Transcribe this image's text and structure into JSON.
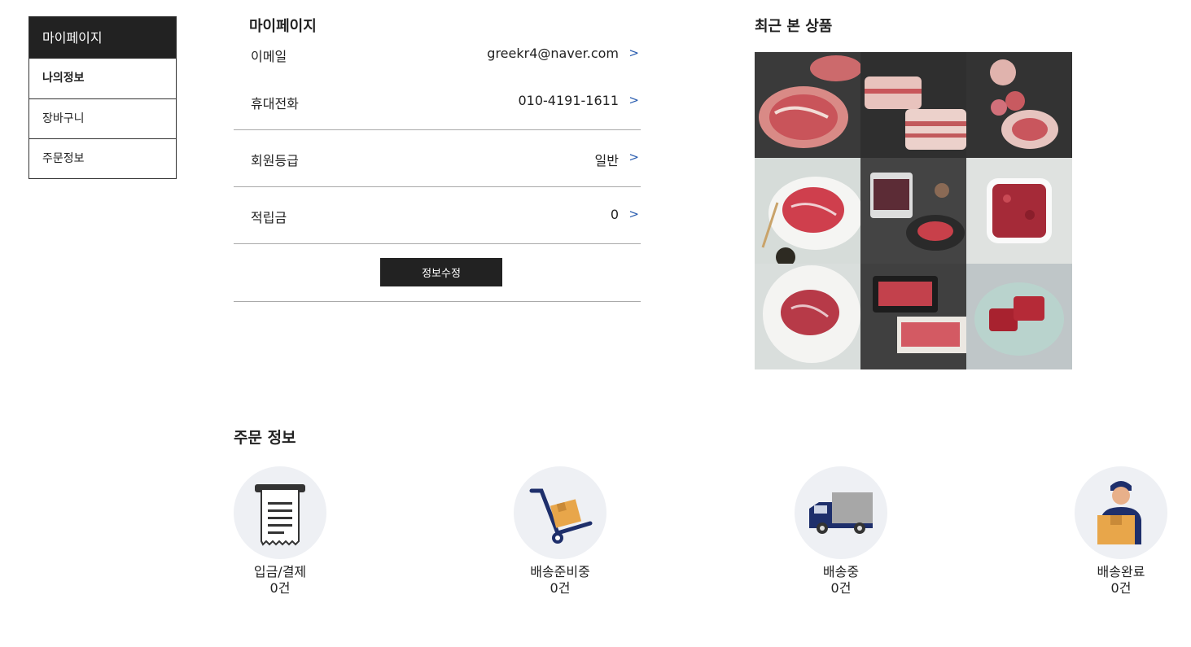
{
  "sidebar": {
    "title": "마이페이지",
    "items": [
      {
        "label": "나의정보"
      },
      {
        "label": "장바구니"
      },
      {
        "label": "주문정보"
      }
    ]
  },
  "info": {
    "title": "마이페이지",
    "email_label": "이메일",
    "email_value": "greekr4@naver.com",
    "phone_label": "휴대전화",
    "phone_value": "010-4191-1611",
    "grade_label": "회원등급",
    "grade_value": "일반",
    "points_label": "적립금",
    "points_value": "0",
    "arrow": ">",
    "edit_button": "정보수정"
  },
  "recent": {
    "title": "최근 본 상품",
    "products": [
      "pork-neck",
      "pork-belly",
      "pork-chunks",
      "sliced-beef-plate",
      "packaged-beef",
      "ground-beef-bowl",
      "steak-plate",
      "packaged-sirloin",
      "beef-cubes-plate"
    ]
  },
  "orders": {
    "title": "주문 정보",
    "statuses": [
      {
        "name": "입금/결제",
        "count": "0건",
        "icon": "receipt-icon"
      },
      {
        "name": "배송준비중",
        "count": "0건",
        "icon": "hand-truck-icon"
      },
      {
        "name": "배송중",
        "count": "0건",
        "icon": "delivery-truck-icon"
      },
      {
        "name": "배송완료",
        "count": "0건",
        "icon": "delivery-person-icon"
      }
    ]
  },
  "colors": {
    "dark": "#222222",
    "accent_arrow": "#2a5db0",
    "circle_bg": "#eef0f4"
  }
}
